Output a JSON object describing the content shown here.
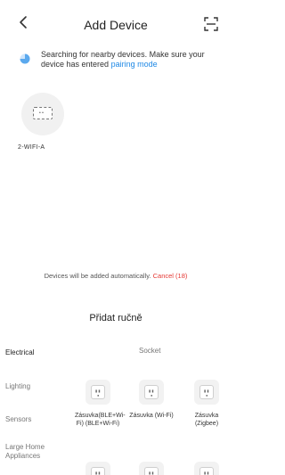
{
  "header": {
    "title": "Add Device",
    "back_icon": "chevron-left-icon",
    "scan_icon": "scan-icon"
  },
  "search": {
    "text": "Searching for nearby devices. Make sure your device has entered",
    "link": "pairing mode"
  },
  "found_devices": [
    {
      "name": "2-WIFI-A",
      "icon": "plug-icon"
    }
  ],
  "auto_add": {
    "text": "Devices will be added automatically.",
    "cancel_label": "Cancel (18)"
  },
  "manual": {
    "title": "Přidat ručně",
    "categories": [
      {
        "label": "Electrical",
        "active": true
      },
      {
        "label": "Lighting",
        "active": false
      },
      {
        "label": "Sensors",
        "active": false
      },
      {
        "label": "Large Home Appliances",
        "active": false
      }
    ],
    "section_header": "Socket",
    "products": [
      {
        "label": "Zásuvka(BLE+Wi-Fi) (BLE+Wi-Fi)"
      },
      {
        "label": "Zásuvka (Wi-Fi)"
      },
      {
        "label": "Zásuvka (Zigbee)"
      }
    ]
  },
  "colors": {
    "link": "#1e88e5",
    "cancel": "#e53935",
    "spinner": "#5ba9ee"
  }
}
